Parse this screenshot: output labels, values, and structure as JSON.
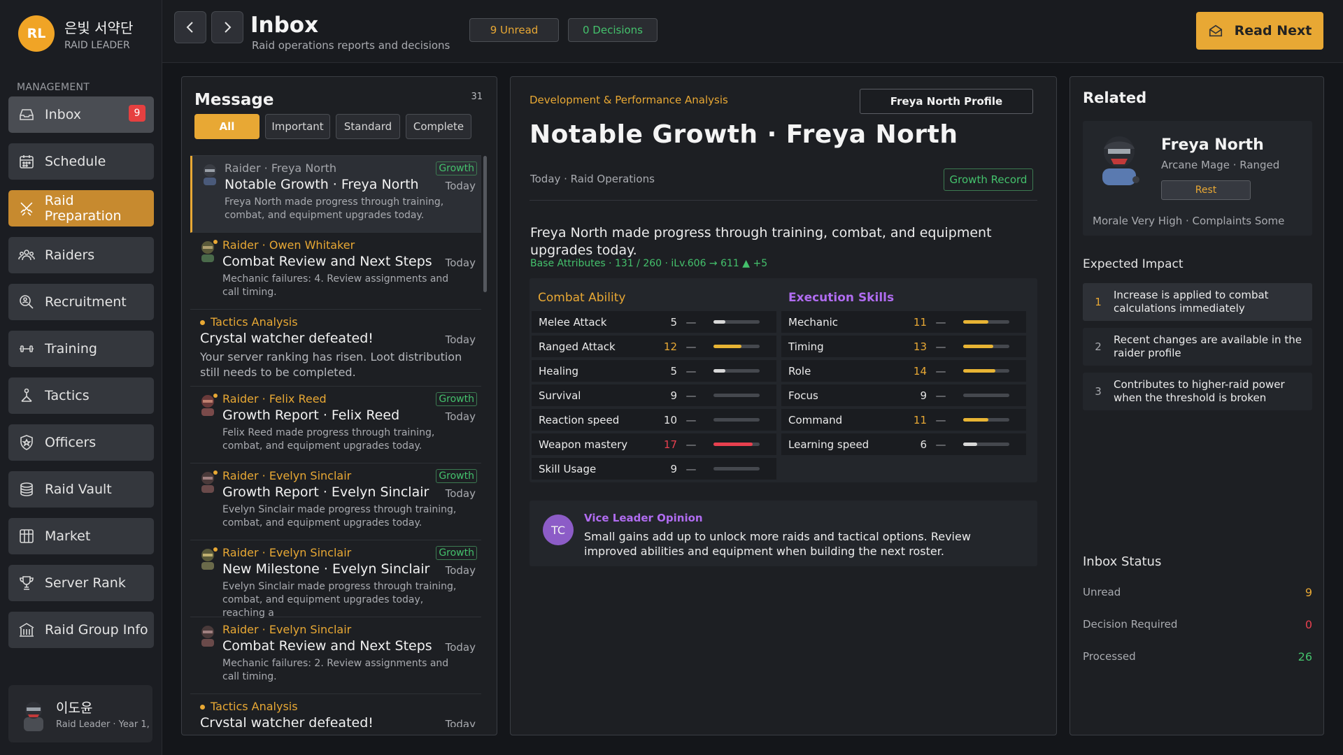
{
  "guild": {
    "initials": "RL",
    "name": "은빛 서약단",
    "role": "RAID LEADER"
  },
  "sidebar": {
    "section": "MANAGEMENT",
    "items": [
      {
        "label": "Inbox",
        "badge": "9"
      },
      {
        "label": "Schedule"
      },
      {
        "label": "Raid Preparation"
      },
      {
        "label": "Raiders"
      },
      {
        "label": "Recruitment"
      },
      {
        "label": "Training"
      },
      {
        "label": "Tactics"
      },
      {
        "label": "Officers"
      },
      {
        "label": "Raid Vault"
      },
      {
        "label": "Market"
      },
      {
        "label": "Server Rank"
      },
      {
        "label": "Raid Group Info"
      }
    ],
    "profile": {
      "name": "이도윤",
      "sub": "Raid Leader · Year 1,"
    }
  },
  "header": {
    "title": "Inbox",
    "subtitle": "Raid operations reports and decisions",
    "unread_pill": "9 Unread",
    "decisions_pill": "0 Decisions",
    "read_next": "Read Next"
  },
  "messages": {
    "title": "Message",
    "count": "31",
    "filters": [
      "All",
      "Important",
      "Standard",
      "Complete"
    ],
    "items": [
      {
        "from": "Raider · Freya North",
        "subject": "Notable Growth · Freya North",
        "body": "Freya North made progress through training, combat, and equipment upgrades today.",
        "tag": "Growth",
        "date": "Today"
      },
      {
        "from": "Raider · Owen Whitaker",
        "subject": "Combat Review and Next Steps",
        "body": "Mechanic failures: 4. Review assignments and call timing.",
        "tag": "",
        "date": "Today"
      },
      {
        "from": "Tactics Analysis",
        "subject": "Crystal watcher defeated!",
        "body": "Your server ranking has risen. Loot distribution still needs to be completed.",
        "tag": "",
        "date": "Today"
      },
      {
        "from": "Raider · Felix Reed",
        "subject": "Growth Report · Felix Reed",
        "body": "Felix Reed made progress through training, combat, and equipment upgrades today.",
        "tag": "Growth",
        "date": "Today"
      },
      {
        "from": "Raider · Evelyn Sinclair",
        "subject": "Growth Report · Evelyn Sinclair",
        "body": "Evelyn Sinclair made progress through training, combat, and equipment upgrades today.",
        "tag": "Growth",
        "date": "Today"
      },
      {
        "from": "Raider · Evelyn Sinclair",
        "subject": "New Milestone · Evelyn Sinclair",
        "body": "Evelyn Sinclair made progress through training, combat, and equipment upgrades today, reaching a",
        "tag": "Growth",
        "date": "Today"
      },
      {
        "from": "Raider · Evelyn Sinclair",
        "subject": "Combat Review and Next Steps",
        "body": "Mechanic failures: 2. Review assignments and call timing.",
        "tag": "",
        "date": "Today"
      },
      {
        "from": "Tactics Analysis",
        "subject": "Crystal watcher defeated!",
        "body": "",
        "tag": "",
        "date": "Today"
      }
    ]
  },
  "detail": {
    "category": "Development & Performance Analysis",
    "profile_button": "Freya North Profile",
    "title": "Notable Growth · Freya North",
    "meta": "Today · Raid Operations",
    "record_button": "Growth Record",
    "body": "Freya North made progress through training, combat, and equipment upgrades today.",
    "stats": "Base Attributes · 131 / 260  ·  iLv.606 → 611  ▲ +5",
    "combat_title": "Combat Ability",
    "execution_title": "Execution Skills",
    "combat": [
      {
        "name": "Melee Attack",
        "value": "5",
        "change": "—",
        "level": 0.25,
        "color": "#d8d8d8",
        "value_color": "#e4e4e4"
      },
      {
        "name": "Ranged Attack",
        "value": "12",
        "change": "—",
        "level": 0.6,
        "color": "#e8b434",
        "value_color": "#e8a834"
      },
      {
        "name": "Healing",
        "value": "5",
        "change": "—",
        "level": 0.25,
        "color": "#d8d8d8",
        "value_color": "#e4e4e4"
      },
      {
        "name": "Survival",
        "value": "9",
        "change": "—",
        "level": 0.0,
        "color": "#d8d8d8",
        "value_color": "#e4e4e4"
      },
      {
        "name": "Reaction speed",
        "value": "10",
        "change": "—",
        "level": 0.0,
        "color": "#d8d8d8",
        "value_color": "#e4e4e4"
      },
      {
        "name": "Weapon mastery",
        "value": "17",
        "change": "—",
        "level": 0.85,
        "color": "#e8404f",
        "value_color": "#e8404f"
      },
      {
        "name": "Skill Usage",
        "value": "9",
        "change": "—",
        "level": 0.0,
        "color": "#d8d8d8",
        "value_color": "#e4e4e4"
      }
    ],
    "execution": [
      {
        "name": "Mechanic",
        "value": "11",
        "change": "—",
        "level": 0.55,
        "color": "#e8b434",
        "value_color": "#e8a834"
      },
      {
        "name": "Timing",
        "value": "13",
        "change": "—",
        "level": 0.65,
        "color": "#e8b434",
        "value_color": "#e8a834"
      },
      {
        "name": "Role",
        "value": "14",
        "change": "—",
        "level": 0.7,
        "color": "#e8b434",
        "value_color": "#e8a834"
      },
      {
        "name": "Focus",
        "value": "9",
        "change": "—",
        "level": 0.0,
        "color": "#d8d8d8",
        "value_color": "#e4e4e4"
      },
      {
        "name": "Command",
        "value": "11",
        "change": "—",
        "level": 0.55,
        "color": "#e8b434",
        "value_color": "#e8a834"
      },
      {
        "name": "Learning speed",
        "value": "6",
        "change": "—",
        "level": 0.3,
        "color": "#d8d8d8",
        "value_color": "#e4e4e4"
      }
    ],
    "opinion": {
      "initials": "TC",
      "title": "Vice Leader Opinion",
      "text": "Small gains add up to unlock more raids and tactical options. Review improved abilities and equipment when building the next roster."
    }
  },
  "related": {
    "title": "Related",
    "name": "Freya North",
    "class": "Arcane Mage · Ranged",
    "rest_button": "Rest",
    "morale": "Morale Very High · Complaints Some",
    "impact_title": "Expected Impact",
    "impacts": [
      {
        "num": "1",
        "text": "Increase is applied to combat calculations immediately"
      },
      {
        "num": "2",
        "text": "Recent changes are available in the raider profile"
      },
      {
        "num": "3",
        "text": "Contributes to higher-raid power when the threshold is broken"
      }
    ],
    "status_title": "Inbox Status",
    "status": [
      {
        "label": "Unread",
        "value": "9",
        "color": "#e8a834"
      },
      {
        "label": "Decision Required",
        "value": "0",
        "color": "#e8404f"
      },
      {
        "label": "Processed",
        "value": "26",
        "color": "#44c16c"
      }
    ]
  },
  "colors": {
    "accent": "#e8a834",
    "green": "#44c16c",
    "red": "#e8404f",
    "purple": "#b06cf0"
  }
}
